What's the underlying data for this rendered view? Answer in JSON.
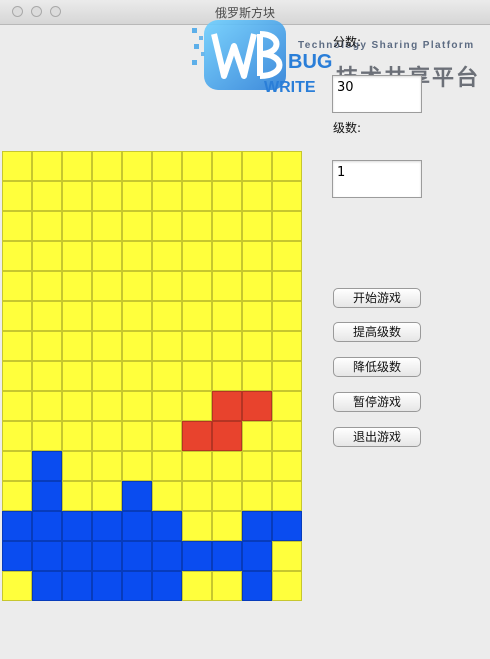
{
  "window": {
    "title": "俄罗斯方块"
  },
  "watermark": {
    "logo_text": "WBUG WRITE",
    "logo_word_bug": "BUG",
    "logo_word_write": "WRITE",
    "tagline": "Technology Sharing Platform",
    "cn_text": "技术共享平台"
  },
  "panel": {
    "score_label": "分数:",
    "score_value": "30",
    "level_label": "级数:",
    "level_value": "1"
  },
  "buttons": {
    "start": "开始游戏",
    "level_up": "提高级数",
    "level_down": "降低级数",
    "pause": "暂停游戏",
    "exit": "退出游戏"
  },
  "colors": {
    "empty": "#ffff3c",
    "active": "#e8432d",
    "locked": "#0a4cf0"
  },
  "board": {
    "cols": 10,
    "rows": [
      "..........",
      "..........",
      "..........",
      "..........",
      "..........",
      "..........",
      "..........",
      "..........",
      ".......RR.",
      "......RR..",
      ".B........",
      ".B..B.....",
      "BBBBBB..BB",
      "BBBBBBBBB.",
      ".BBBBB..B."
    ]
  }
}
